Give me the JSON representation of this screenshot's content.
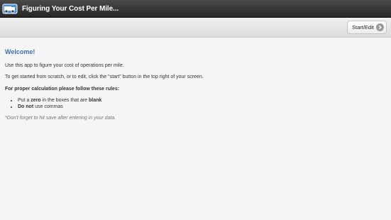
{
  "app": {
    "title": "Figuring Your Cost Per Mile...",
    "icon": "truck-icon"
  },
  "toolbar": {
    "start_edit_label": "Start/Edit",
    "start_edit_icon": "chevron-right-circle-icon"
  },
  "main": {
    "welcome": "Welcome!",
    "intro": "Use this app to figure your cost of operations per mile.",
    "instructions": "To get started from scratch, or to edit, click the \"start\" button in the top right of your screen.",
    "rules_heading": "For proper calculation please follow these rules:",
    "rules": [
      {
        "pre": "Put a ",
        "bold1": "zero",
        "mid": " in the boxes that are ",
        "bold2": "blank"
      },
      {
        "bold1": "Do not",
        "post": " use commas"
      }
    ],
    "note": "*Don't forget to hit save after entering in your data."
  },
  "colors": {
    "titlebar": "#2f2f2f",
    "accent": "#3b6fae",
    "background": "#f4f5f4"
  }
}
